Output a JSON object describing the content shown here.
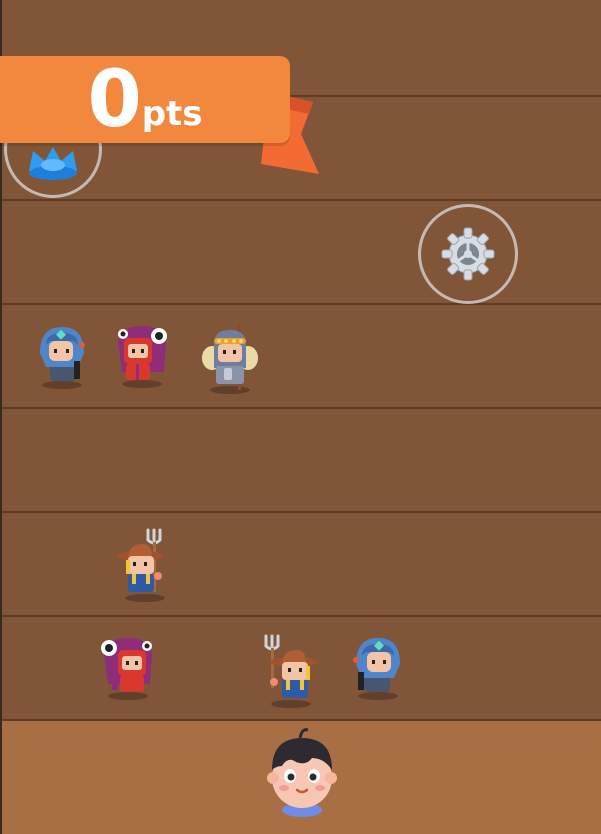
{
  "score": {
    "value": "0",
    "unit": "pts"
  },
  "colors": {
    "board": "#815638",
    "lane_line": "#5f3c26",
    "home_row": "#a86f45",
    "banner": "#f2883d",
    "ribbon": "#f46a33",
    "power_icon": "#2f9cf0"
  },
  "lanes": [
    {
      "row": 1,
      "characters": []
    },
    {
      "row": 2,
      "characters": []
    },
    {
      "row": 3,
      "characters": [
        "blue-hooded-mage",
        "red-dino-costume-kid",
        "armored-knight-with-spear"
      ]
    },
    {
      "row": 4,
      "characters": []
    },
    {
      "row": 5,
      "characters": [
        "farmer-with-pitchfork"
      ]
    },
    {
      "row": 6,
      "characters": [
        "red-dino-costume-kid",
        "farmer-with-pitchfork",
        "blue-hooded-mage"
      ]
    }
  ],
  "player": {
    "icon": "boy-face-avatar"
  },
  "buttons": {
    "power_icon": "blue-crown-icon",
    "settings_icon": "gear-icon"
  }
}
